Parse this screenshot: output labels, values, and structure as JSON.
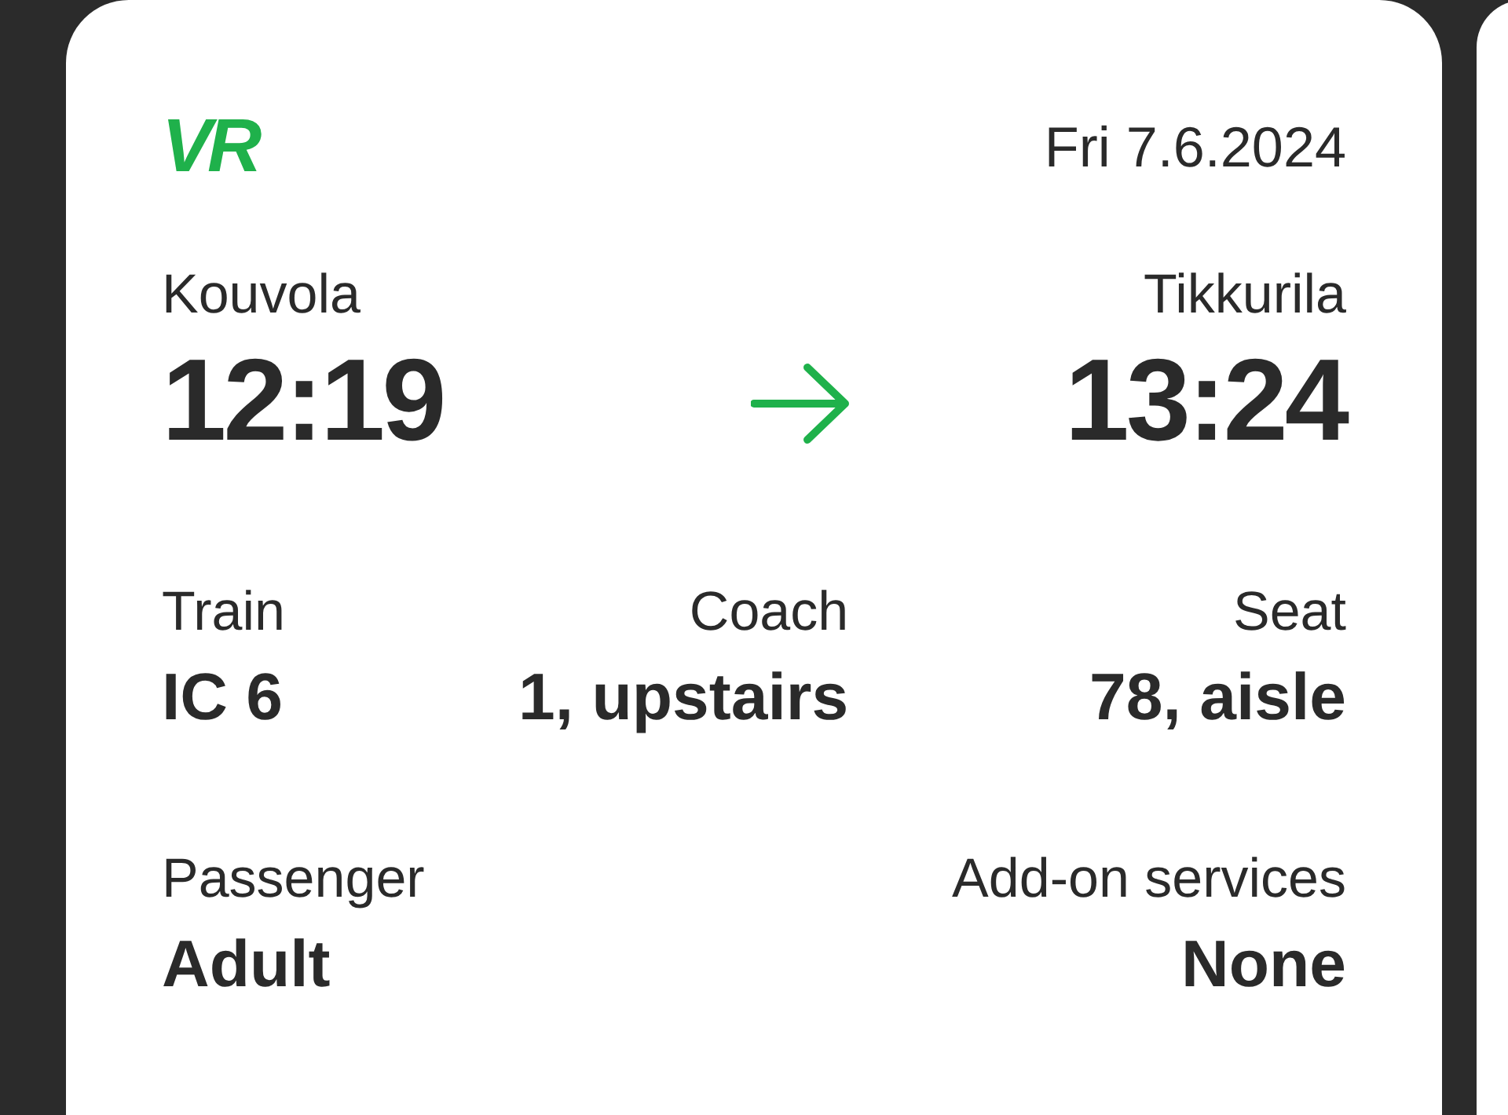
{
  "ticket": {
    "logo": "VR",
    "date": "Fri 7.6.2024",
    "departure": {
      "station": "Kouvola",
      "time": "12:19"
    },
    "arrival": {
      "station": "Tikkurila",
      "time": "13:24"
    },
    "details": [
      {
        "label": "Train",
        "value": "IC 6"
      },
      {
        "label": "Coach",
        "value": "1, upstairs"
      },
      {
        "label": "Seat",
        "value": "78, aisle"
      }
    ],
    "extras": [
      {
        "label": "Passenger",
        "value": "Adult"
      },
      {
        "label": "Add-on services",
        "value": "None"
      }
    ]
  }
}
